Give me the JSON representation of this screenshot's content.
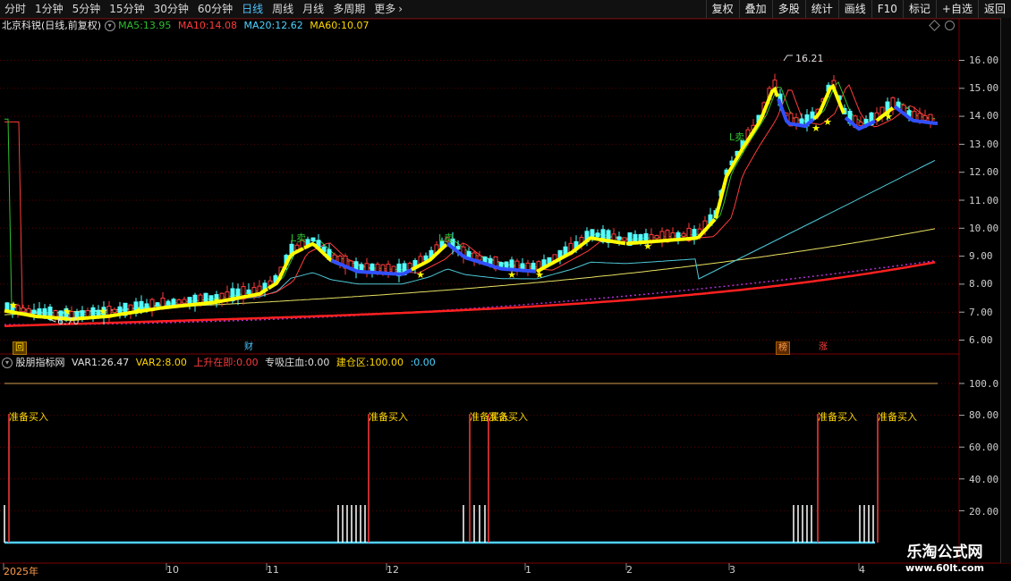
{
  "toolbar": {
    "periods": [
      "分时",
      "1分钟",
      "5分钟",
      "15分钟",
      "30分钟",
      "60分钟",
      "日线",
      "周线",
      "月线",
      "多周期",
      "更多"
    ],
    "active_period": "日线",
    "actions": [
      "复权",
      "叠加",
      "多股",
      "统计",
      "画线",
      "F10",
      "标记",
      "+自选",
      "返回"
    ]
  },
  "main_chart": {
    "stock_title": "北京科锐(日线,前复权)",
    "ma": [
      {
        "label": "MA5:",
        "value": "13.95",
        "color": "#2fbf2f"
      },
      {
        "label": "MA10:",
        "value": "14.08",
        "color": "#ff3b3b"
      },
      {
        "label": "MA20:",
        "value": "12.62",
        "color": "#4fd2ff"
      },
      {
        "label": "MA60:",
        "value": "10.07",
        "color": "#ffd700"
      }
    ],
    "price_axis": [
      "16.00",
      "15.00",
      "14.00",
      "13.00",
      "12.00",
      "11.00",
      "10.00",
      "9.00",
      "8.00",
      "7.00",
      "6.00"
    ],
    "high_marker": "16.21",
    "low_marker": "6.70",
    "sell_labels": [
      "L卖",
      "L卖",
      "L卖"
    ],
    "event_tags": [
      {
        "text": "回",
        "color": "#ffd700",
        "bg": "#5a3a00"
      },
      {
        "text": "财",
        "color": "#4ec3ff",
        "bg": "transparent"
      },
      {
        "text": "榜",
        "color": "#ff9c4a",
        "bg": "#5a2a00"
      },
      {
        "text": "涨",
        "color": "#ff4040",
        "bg": "transparent"
      }
    ]
  },
  "indicator": {
    "name": "股朋指标网",
    "fields": [
      {
        "label": "VAR1:",
        "value": "26.47",
        "color": "#e0e0e0"
      },
      {
        "label": "VAR2:",
        "value": "8.00",
        "color": "#ffd700"
      },
      {
        "label": "上升在即:",
        "value": "0.00",
        "color": "#ff3b3b"
      },
      {
        "label": "专吸庄血:",
        "value": "0.00",
        "color": "#e0e0e0"
      },
      {
        "label": "建仓区:",
        "value": "100.00",
        "color": "#ffd700"
      },
      {
        "label": ":",
        "value": "0.00",
        "color": "#4fd2ff"
      }
    ],
    "axis": [
      "100.0",
      "80.00",
      "60.00",
      "40.00",
      "20.00"
    ],
    "buy_signal": "准备买入",
    "buy_label_text": [
      "准备买入",
      "准备买入",
      "准备买入",
      "准备买入",
      "准备买入",
      "准备买入"
    ]
  },
  "time_axis": [
    "2025年",
    "10",
    "11",
    "12",
    "1",
    "2",
    "3",
    "4"
  ],
  "watermark": {
    "title": "乐淘公式网",
    "url": "www.60lt.com"
  }
}
